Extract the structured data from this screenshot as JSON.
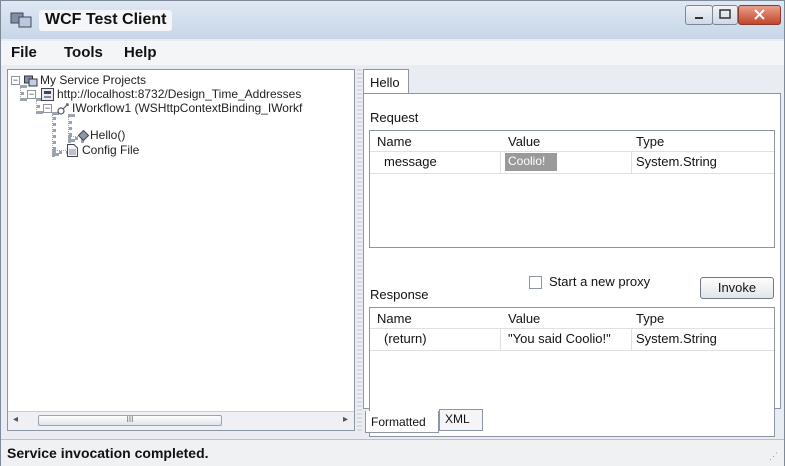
{
  "window": {
    "title": "WCF Test Client"
  },
  "menu": {
    "items": [
      "File",
      "Tools",
      "Help"
    ]
  },
  "tree": {
    "root": "My Service Projects",
    "endpoint": "http://localhost:8732/Design_Time_Addresses",
    "contract": "IWorkflow1 (WSHttpContextBinding_IWorkf",
    "operation": "Hello()",
    "config": "Config File"
  },
  "scrollbar": {
    "grip": "III"
  },
  "tab": {
    "label": "Hello"
  },
  "request": {
    "label": "Request",
    "columns": [
      "Name",
      "Value",
      "Type"
    ],
    "rows": [
      {
        "name": "message",
        "value": "Coolio!",
        "type": "System.String"
      }
    ]
  },
  "controls": {
    "new_proxy_label": "Start a new proxy",
    "invoke_label": "Invoke"
  },
  "response": {
    "label": "Response",
    "columns": [
      "Name",
      "Value",
      "Type"
    ],
    "rows": [
      {
        "name": "(return)",
        "value": "\"You said Coolio!\"",
        "type": "System.String"
      }
    ]
  },
  "bottom_tabs": [
    "Formatted",
    "XML"
  ],
  "status": {
    "text": "Service invocation completed."
  }
}
